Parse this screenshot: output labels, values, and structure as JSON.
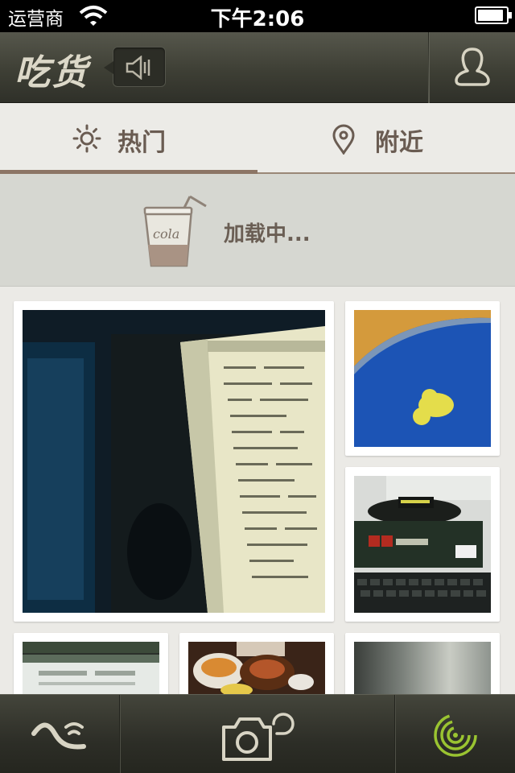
{
  "status_bar": {
    "carrier": "运营商",
    "time": "下午2:06",
    "battery_level": 0.92
  },
  "navbar": {
    "logo_text": "吃货",
    "sound_icon": "speaker-muted-icon",
    "profile_icon": "user-icon"
  },
  "tabs": [
    {
      "label": "热门",
      "icon": "sun-icon",
      "active": true
    },
    {
      "label": "附近",
      "icon": "location-pin-icon",
      "active": false
    }
  ],
  "loading": {
    "text": "加载中...",
    "cup_label": "cola"
  },
  "photos": [
    {
      "description": "monitor-screen",
      "colors": [
        "#0d1a26",
        "#e7e6c8"
      ]
    },
    {
      "description": "blue-surface-with-yellow-sticker",
      "colors": [
        "#1f55b8",
        "#e6e04a"
      ]
    },
    {
      "description": "monitor-on-box-keyboard",
      "colors": [
        "#dadcd9",
        "#1f2a22"
      ]
    },
    {
      "description": "office-screens",
      "colors": [
        "#2a2f2a",
        "#e8ece8"
      ]
    },
    {
      "description": "food-plates",
      "colors": [
        "#4b2a18",
        "#d98a3a"
      ]
    },
    {
      "description": "blurry-object",
      "colors": [
        "#5a5e5a",
        "#c9ccc4"
      ]
    }
  ],
  "toolbar": {
    "feed_icon": "wave-signal-icon",
    "camera_icon": "camera-icon",
    "radar_icon": "radar-icon"
  },
  "colors": {
    "accent_green": "#9ac431",
    "tab_underline": "#8c7565",
    "tab_text": "#6a5c52"
  }
}
